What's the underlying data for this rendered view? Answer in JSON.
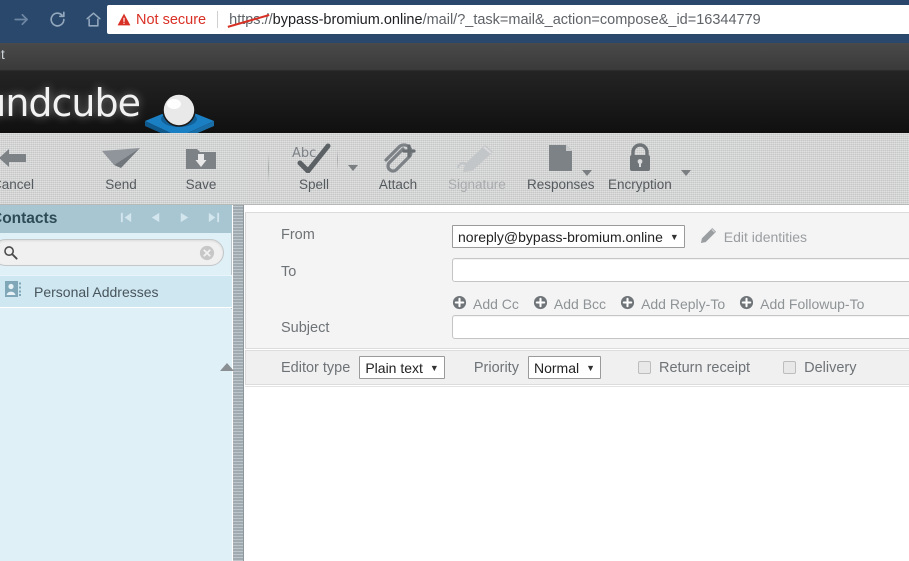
{
  "browser": {
    "security_label": "Not secure",
    "url_scheme": "https",
    "url_sep": "://",
    "url_host": "bypass-bromium.online",
    "url_path": "/mail/?_task=mail&_action=compose&_id=16344779",
    "nav_forward_icon": "forward-arrow-icon",
    "nav_reload_icon": "reload-icon",
    "nav_home_icon": "home-icon",
    "warning_icon": "warning-triangle-icon"
  },
  "app": {
    "logout_label": "out",
    "logo_text": "oundcube"
  },
  "toolbar": {
    "buttons": [
      {
        "label": "Cancel",
        "icon": "back-arrow-icon",
        "disabled": false,
        "dropdown": false
      },
      {
        "label": "Send",
        "icon": "paper-plane-icon",
        "disabled": false,
        "dropdown": false
      },
      {
        "label": "Save",
        "icon": "save-folder-icon",
        "disabled": false,
        "dropdown": false
      },
      {
        "label": "Spell",
        "icon": "spellcheck-icon",
        "disabled": false,
        "dropdown": true
      },
      {
        "label": "Attach",
        "icon": "paperclip-plus-icon",
        "disabled": false,
        "dropdown": false
      },
      {
        "label": "Signature",
        "icon": "pencil-signature-icon",
        "disabled": true,
        "dropdown": false
      },
      {
        "label": "Responses",
        "icon": "document-icon",
        "disabled": false,
        "dropdown": true
      },
      {
        "label": "Encryption",
        "icon": "lock-icon",
        "disabled": false,
        "dropdown": true
      }
    ]
  },
  "sidebar": {
    "title": "Contacts",
    "nav": {
      "first_icon": "first-page-icon",
      "prev_icon": "prev-page-icon",
      "next_icon": "next-page-icon",
      "last_icon": "last-page-icon"
    },
    "search": {
      "value": "",
      "placeholder": "",
      "icon": "search-icon",
      "clear_icon": "clear-circle-icon"
    },
    "groups": [
      {
        "label": "Personal Addresses",
        "icon": "address-book-icon"
      }
    ]
  },
  "compose": {
    "from_label": "From",
    "from_value": "noreply@bypass-bromium.online",
    "edit_identities_label": "Edit identities",
    "edit_identities_icon": "pencil-icon",
    "to_label": "To",
    "to_value": "",
    "subject_label": "Subject",
    "subject_value": "",
    "add_links": [
      {
        "label": "Add Cc",
        "icon": "plus-circle-icon"
      },
      {
        "label": "Add Bcc",
        "icon": "plus-circle-icon"
      },
      {
        "label": "Add Reply-To",
        "icon": "plus-circle-icon"
      },
      {
        "label": "Add Followup-To",
        "icon": "plus-circle-icon"
      }
    ],
    "options": {
      "collapse_icon": "collapse-up-icon",
      "editor_type_label": "Editor type",
      "editor_type_value": "Plain text",
      "priority_label": "Priority",
      "priority_value": "Normal",
      "return_receipt_label": "Return receipt",
      "return_receipt_checked": false,
      "delivery_label": "Delivery",
      "delivery_checked": false
    },
    "body_value": ""
  },
  "colors": {
    "browser_chrome": "#29486b",
    "warning_red": "#d93025",
    "sidebar_header": "#a8c6d2",
    "sidebar_bg": "#e0f0f7",
    "toolbar_bg": "#cfd0d0"
  }
}
